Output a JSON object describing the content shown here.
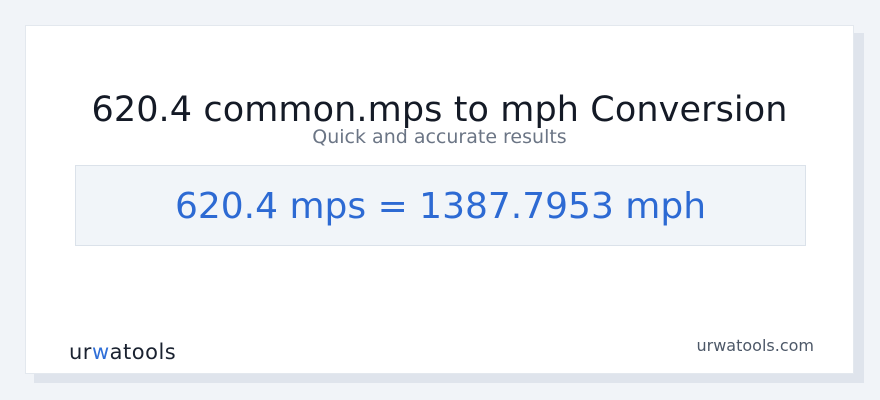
{
  "header": {
    "title": "620.4 common.mps to mph Conversion",
    "subtitle": "Quick and accurate results"
  },
  "result": {
    "text": "620.4 mps = 1387.7953 mph"
  },
  "footer": {
    "logo": {
      "part1": "ur",
      "accent": "w",
      "part2": "atools"
    },
    "site": "urwatools.com"
  },
  "colors": {
    "accent": "#2d6ad3",
    "title": "#141a26",
    "background": "#f1f4f8"
  }
}
